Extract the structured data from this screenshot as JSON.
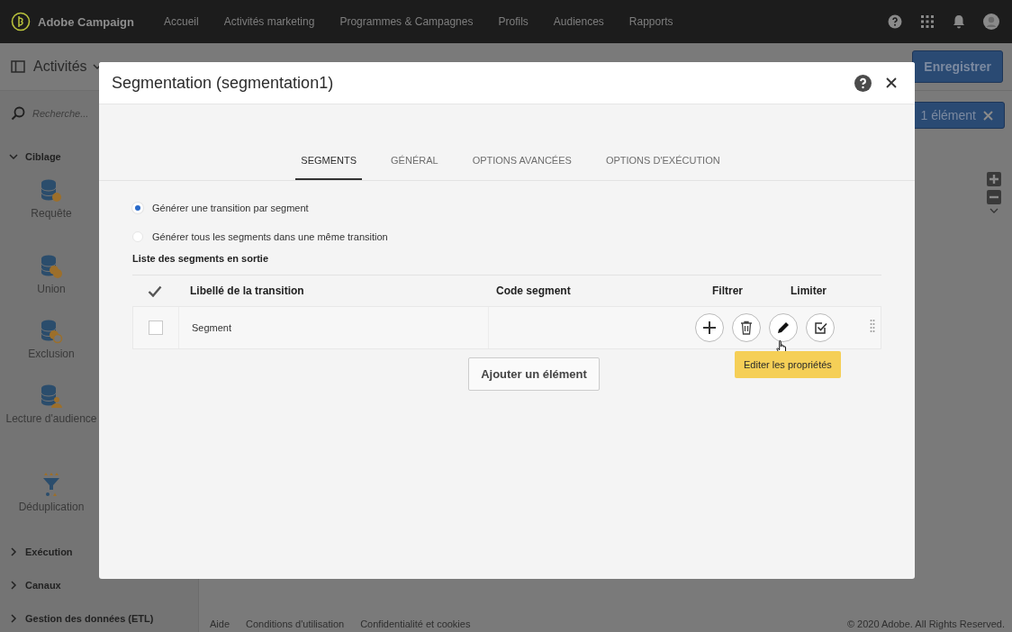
{
  "top_nav": {
    "brand": "Adobe Campaign",
    "items": [
      {
        "label": "Accueil"
      },
      {
        "label": "Activités marketing"
      },
      {
        "label": "Programmes & Campagnes"
      },
      {
        "label": "Profils"
      },
      {
        "label": "Audiences"
      },
      {
        "label": "Rapports"
      }
    ]
  },
  "toolbar": {
    "title": "Activités",
    "save_button": "Enregistrer",
    "selection_button": "1 élément"
  },
  "sidebar": {
    "search": {
      "placeholder": "Recherche..."
    },
    "sections": [
      {
        "label": "Ciblage",
        "expanded": true,
        "items": [
          {
            "label": "Requête",
            "kind": "query"
          },
          {
            "label": "Union",
            "kind": "union"
          },
          {
            "label": "Exclusion",
            "kind": "exclusion"
          },
          {
            "label": "Lecture d'audience",
            "kind": "audience"
          },
          {
            "label": "Déduplication",
            "kind": "dedup"
          }
        ]
      },
      {
        "label": "Exécution",
        "expanded": false
      },
      {
        "label": "Canaux",
        "expanded": false
      },
      {
        "label": "Gestion des données (ETL)",
        "expanded": false
      }
    ]
  },
  "footer": {
    "links": [
      "Aide",
      "Conditions d'utilisation",
      "Confidentialité et cookies"
    ],
    "copyright": "© 2020 Adobe. All Rights Reserved."
  },
  "dialog": {
    "title": "Segmentation (segmentation1)",
    "tabs": [
      {
        "label": "SEGMENTS",
        "selected": true
      },
      {
        "label": "GÉNÉRAL",
        "selected": false
      },
      {
        "label": "OPTIONS AVANCÉES",
        "selected": false
      },
      {
        "label": "OPTIONS D'EXÉCUTION",
        "selected": false
      }
    ],
    "options": [
      {
        "label": "Générer une transition par segment",
        "selected": true
      },
      {
        "label": "Générer tous les segments dans une même transition",
        "selected": false
      }
    ],
    "list_title": "Liste des segments en sortie",
    "table": {
      "columns": [
        "Libellé de la transition",
        "Code segment",
        "Filtrer",
        "Limiter"
      ],
      "rows": [
        {
          "checked": false,
          "label": "Segment"
        }
      ]
    },
    "add_button": "Ajouter un élément",
    "tooltip": "Editer les propriétés"
  }
}
